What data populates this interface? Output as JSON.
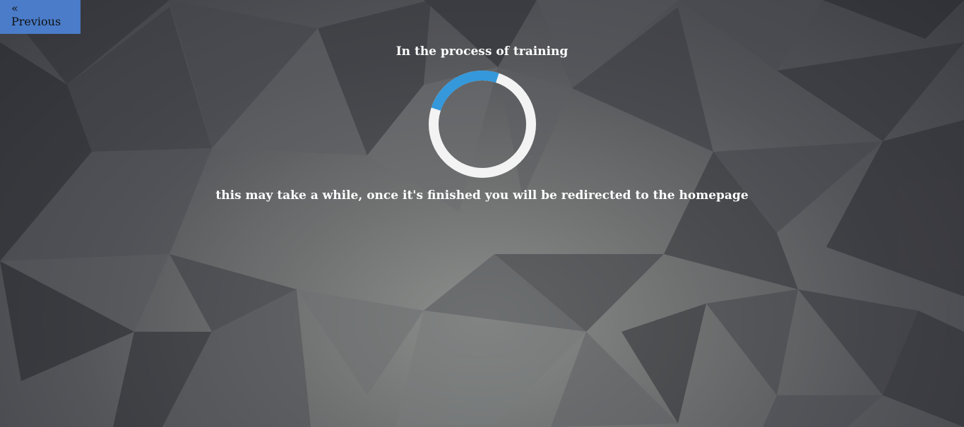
{
  "nav": {
    "prev_arrow": "«",
    "prev_label": "Previous"
  },
  "status": {
    "title": "In the process of training",
    "message": "this may take a while, once it's finished you will be redirected to the homepage"
  },
  "colors": {
    "accent": "#3498db",
    "spinner_track": "#f3f3f3",
    "button_bg": "#4a7cc9"
  }
}
